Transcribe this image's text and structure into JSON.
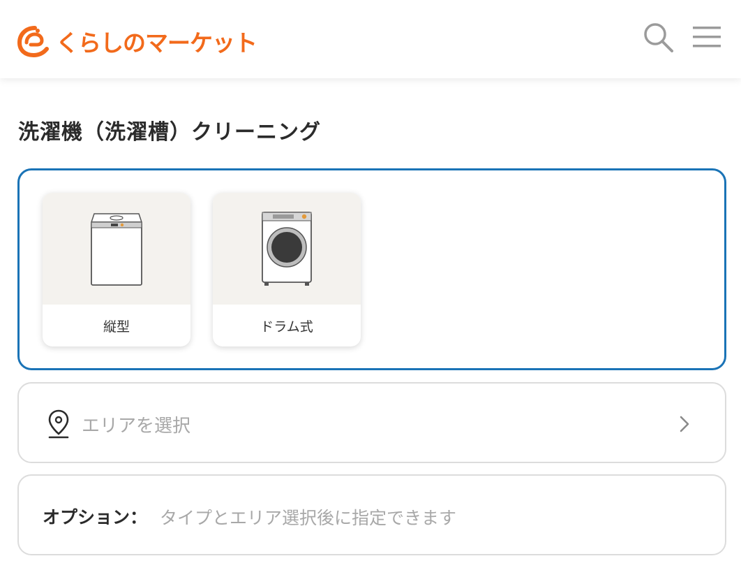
{
  "header": {
    "logo_text": "くらしのマーケット",
    "brand_color": "#f26a1b",
    "search_icon": "search-icon",
    "menu_icon": "hamburger-menu-icon"
  },
  "page": {
    "title": "洗濯機（洗濯槽）クリーニング"
  },
  "type_selector": {
    "border_color": "#1a73b6",
    "options": [
      {
        "label": "縦型",
        "icon": "top-load-washer-icon"
      },
      {
        "label": "ドラム式",
        "icon": "drum-washer-icon"
      }
    ]
  },
  "area": {
    "placeholder": "エリアを選択",
    "icon": "location-pin-icon"
  },
  "options": {
    "label": "オプション：",
    "hint": "タイプとエリア選択後に指定できます"
  }
}
